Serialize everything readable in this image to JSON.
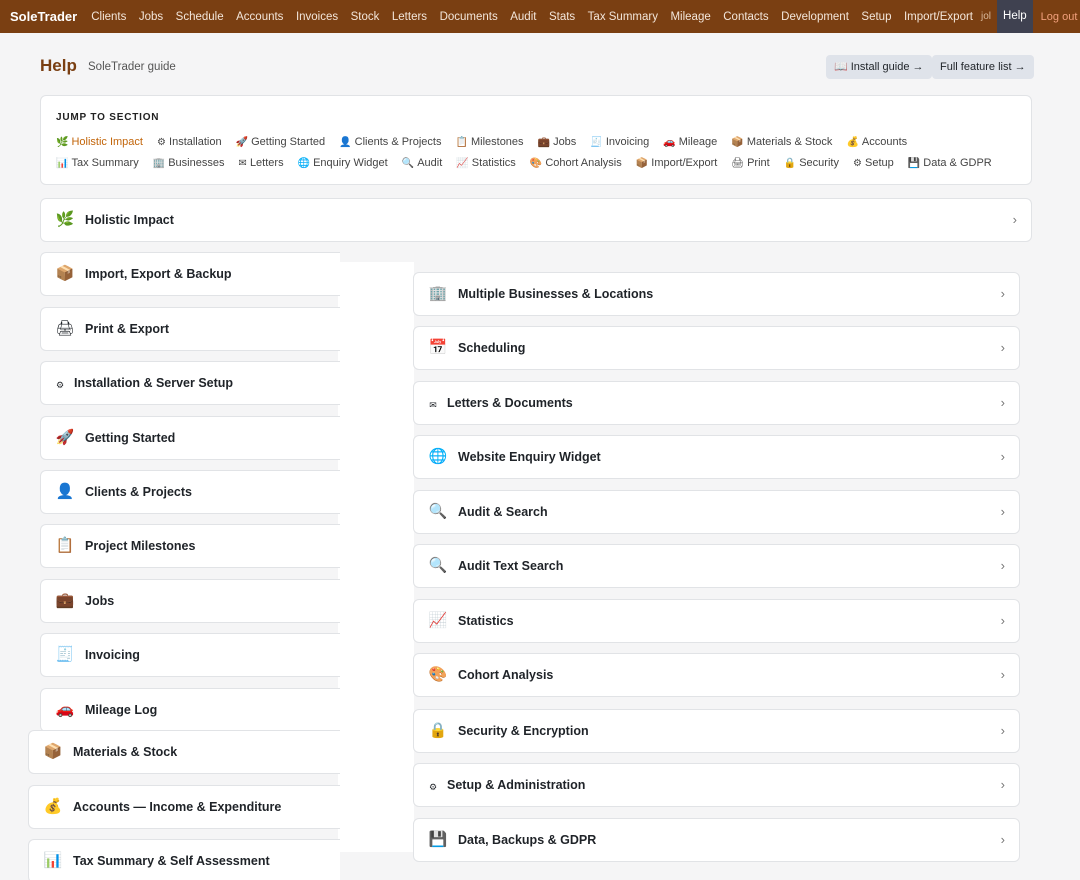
{
  "nav": {
    "brand": "SoleTrader",
    "links": [
      "Clients",
      "Jobs",
      "Schedule",
      "Accounts",
      "Invoices",
      "Stock",
      "Letters",
      "Documents",
      "Audit",
      "Stats",
      "Tax Summary",
      "Mileage",
      "Contacts",
      "Development",
      "Setup",
      "Import/Export"
    ],
    "user": "jol",
    "help": "Help",
    "logout": "Log out"
  },
  "header": {
    "title": "Help",
    "subtitle": "SoleTrader guide",
    "install_btn": "📖 Install guide →",
    "features_btn": "Full feature list →"
  },
  "jump": {
    "title": "JUMP TO SECTION",
    "links": [
      {
        "icon": "🌿",
        "label": "Holistic Impact"
      },
      {
        "icon": "⚙",
        "label": "Installation"
      },
      {
        "icon": "🚀",
        "label": "Getting Started"
      },
      {
        "icon": "👤",
        "label": "Clients & Projects"
      },
      {
        "icon": "📋",
        "label": "Milestones"
      },
      {
        "icon": "💼",
        "label": "Jobs"
      },
      {
        "icon": "🧾",
        "label": "Invoicing"
      },
      {
        "icon": "🚗",
        "label": "Mileage"
      },
      {
        "icon": "📦",
        "label": "Materials & Stock"
      },
      {
        "icon": "💰",
        "label": "Accounts"
      },
      {
        "icon": "📊",
        "label": "Tax Summary"
      },
      {
        "icon": "🏢",
        "label": "Businesses"
      },
      {
        "icon": "✉",
        "label": "Letters"
      },
      {
        "icon": "🌐",
        "label": "Enquiry Widget"
      },
      {
        "icon": "🔍",
        "label": "Audit"
      },
      {
        "icon": "📈",
        "label": "Statistics"
      },
      {
        "icon": "🎨",
        "label": "Cohort Analysis"
      },
      {
        "icon": "📦",
        "label": "Import/Export"
      },
      {
        "icon": "🖨",
        "label": "Print"
      },
      {
        "icon": "🔒",
        "label": "Security"
      },
      {
        "icon": "⚙",
        "label": "Setup"
      },
      {
        "icon": "💾",
        "label": "Data & GDPR"
      }
    ]
  },
  "sections": {
    "holistic": {
      "icon": "🌿",
      "label": "Holistic Impact"
    },
    "left": [
      {
        "icon": "📦",
        "label": "Import, Export & Backup"
      },
      {
        "icon": "🖨",
        "label": "Print & Export"
      },
      {
        "icon": "⚙",
        "label": "Installation & Server Setup"
      },
      {
        "icon": "🚀",
        "label": "Getting Started"
      },
      {
        "icon": "👤",
        "label": "Clients & Projects"
      },
      {
        "icon": "📋",
        "label": "Project Milestones"
      },
      {
        "icon": "💼",
        "label": "Jobs"
      },
      {
        "icon": "🧾",
        "label": "Invoicing"
      },
      {
        "icon": "🚗",
        "label": "Mileage Log"
      }
    ],
    "left2": [
      {
        "icon": "📦",
        "label": "Materials & Stock"
      },
      {
        "icon": "💰",
        "label": "Accounts — Income & Expenditure"
      },
      {
        "icon": "📊",
        "label": "Tax Summary & Self Assessment"
      }
    ],
    "right": [
      {
        "icon": "🏢",
        "label": "Multiple Businesses & Locations"
      },
      {
        "icon": "📅",
        "label": "Scheduling"
      },
      {
        "icon": "✉",
        "label": "Letters & Documents"
      },
      {
        "icon": "🌐",
        "label": "Website Enquiry Widget"
      },
      {
        "icon": "🔍",
        "label": "Audit & Search"
      },
      {
        "icon": "🔍",
        "label": "Audit Text Search"
      },
      {
        "icon": "📈",
        "label": "Statistics"
      },
      {
        "icon": "🎨",
        "label": "Cohort Analysis"
      },
      {
        "icon": "🔒",
        "label": "Security & Encryption"
      },
      {
        "icon": "⚙",
        "label": "Setup & Administration"
      },
      {
        "icon": "💾",
        "label": "Data, Backups & GDPR"
      }
    ],
    "chevron": "›"
  }
}
